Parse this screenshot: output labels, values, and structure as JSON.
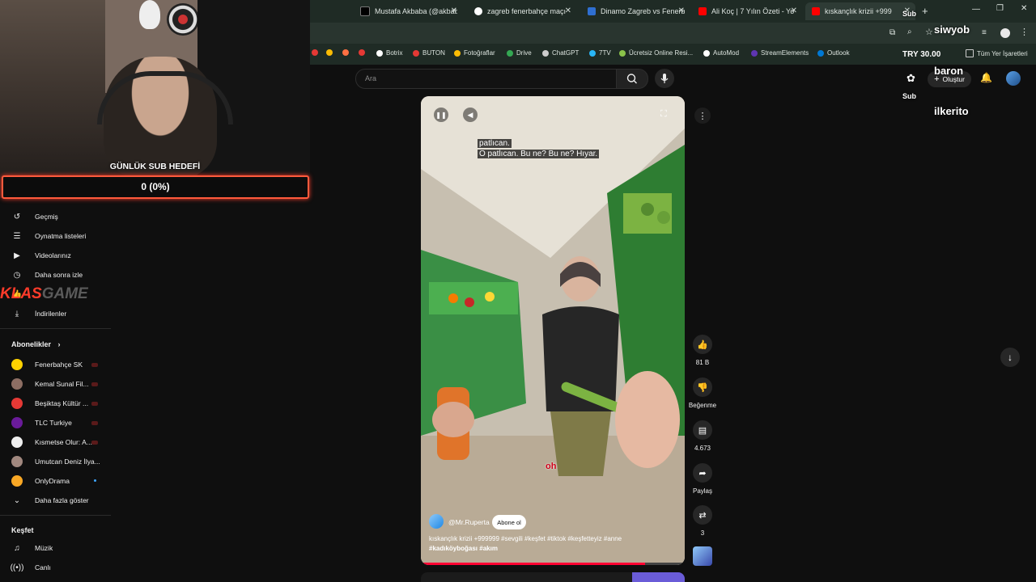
{
  "browser": {
    "tabs": [
      {
        "title": "Mustafa Akbaba (@akbab",
        "fav": "#000000"
      },
      {
        "title": "zagreb fenerbahçe maçı ",
        "fav": "#4285f4"
      },
      {
        "title": "Dinamo Zagreb vs Fenerb",
        "fav": "#2f6fd1"
      },
      {
        "title": "Ali Koç | 7 Yılın Özeti - Yo",
        "fav": "#ff0000"
      },
      {
        "title": "kıskançlık krizii +999",
        "fav": "#ff0000"
      }
    ],
    "bookmarks": [
      {
        "label": "Botrix",
        "color": "#ffffff"
      },
      {
        "label": "BUTON",
        "color": "#e53935"
      },
      {
        "label": "Fotoğraflar",
        "color": "#fbbc04"
      },
      {
        "label": "Drive",
        "color": "#34a853"
      },
      {
        "label": "ChatGPT",
        "color": "#cccccc"
      },
      {
        "label": "7TV",
        "color": "#29b6f6"
      },
      {
        "label": "Ücretsiz Online Resi...",
        "color": "#8bc34a"
      },
      {
        "label": "AutoMod",
        "color": "#ffffff"
      },
      {
        "label": "StreamElements",
        "color": "#5e35b1"
      },
      {
        "label": "Outlook",
        "color": "#0078d4"
      }
    ],
    "all_bookmarks": "Tüm Yer İşaretleri"
  },
  "stream": {
    "goal_title": "GÜNLÜK SUB HEDEFİ",
    "goal_value": "0 (0%)",
    "logo_left": "KLAS",
    "logo_right": "GAME",
    "try_label": "TRY 30.00",
    "alert_user_1": "siwyob",
    "alert_user_2": "baron",
    "alert_user_3": "ilkerito",
    "alert_sub_1": "Sub",
    "alert_sub_2": "Sub"
  },
  "youtube": {
    "search_placeholder": "Ara",
    "create_label": "Oluştur",
    "sidebar": {
      "you_items": [
        "Geçmiş",
        "Oynatma listeleri",
        "Videolarınız",
        "Daha sonra izle",
        "",
        "İndirilenler"
      ],
      "subs_title": "Abonelikler",
      "subs": [
        {
          "name": "Fenerbahçe SK",
          "color": "#ffd200"
        },
        {
          "name": "Kemal Sunal Fil...",
          "color": "#8d6e63"
        },
        {
          "name": "Beşiktaş Kültür ...",
          "color": "#e53935"
        },
        {
          "name": "TLC Turkiye",
          "color": "#6a1b9a"
        },
        {
          "name": "Kısmetse Olur: A...",
          "color": "#eeeeee"
        },
        {
          "name": "Umutcan Deniz İlya...",
          "color": "#a1887f"
        },
        {
          "name": "OnlyDrama",
          "color": "#f9a825"
        }
      ],
      "show_more": "Daha fazla göster",
      "explore_title": "Keşfet",
      "explore_items": [
        "Müzik",
        "Canlı"
      ]
    },
    "short": {
      "caption_line1": "patlıcan.",
      "caption_line2": "O patlıcan. Bu ne? Bu ne? Hıyar.",
      "channel": "@Mr.Ruperta",
      "subscribe": "Abone ol",
      "description_line1": "kıskançlık krizii +999999 #sevgili #keşfet #tiktok #keşfetteyiz #anne",
      "description_line2": "#kadıköyboğası #akım",
      "sticker": "oh",
      "likes": "81 B",
      "dislike_label": "Beğenme",
      "comments": "4.673",
      "share_label": "Paylaş",
      "remix_count": "3"
    }
  }
}
